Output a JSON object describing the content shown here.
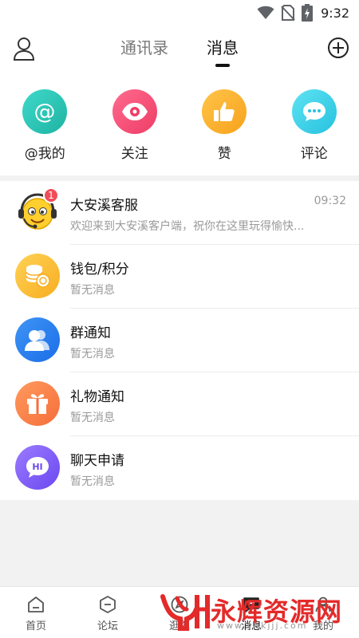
{
  "status_bar": {
    "time": "9:32"
  },
  "header": {
    "tabs": [
      {
        "label": "通讯录",
        "active": false
      },
      {
        "label": "消息",
        "active": true
      }
    ]
  },
  "quick_actions": [
    {
      "label": "@我的",
      "icon": "at-icon",
      "color": "#2ec4b6"
    },
    {
      "label": "关注",
      "icon": "eye-icon",
      "color": "#f2506f"
    },
    {
      "label": "赞",
      "icon": "thumbs-up-icon",
      "color": "#f9b02d"
    },
    {
      "label": "评论",
      "icon": "comment-icon",
      "color": "#3dcfe7"
    }
  ],
  "messages": [
    {
      "title": "大安溪客服",
      "subtitle": "欢迎来到大安溪客户端，祝你在这里玩得愉快...",
      "time": "09:32",
      "badge": "1",
      "icon": "customer-service-avatar-icon"
    },
    {
      "title": "钱包/积分",
      "subtitle": "暂无消息",
      "icon": "coins-icon"
    },
    {
      "title": "群通知",
      "subtitle": "暂无消息",
      "icon": "group-icon"
    },
    {
      "title": "礼物通知",
      "subtitle": "暂无消息",
      "icon": "gift-icon"
    },
    {
      "title": "聊天申请",
      "subtitle": "暂无消息",
      "icon": "chat-hi-icon"
    }
  ],
  "bottom_nav": [
    {
      "label": "首页",
      "icon": "home-icon"
    },
    {
      "label": "论坛",
      "icon": "forum-icon"
    },
    {
      "label": "逛逛",
      "icon": "explore-icon"
    },
    {
      "label": "消息",
      "icon": "message-icon",
      "active": true
    },
    {
      "label": "我的",
      "icon": "profile-icon"
    }
  ],
  "watermark": {
    "text": "永辉资源网",
    "url": "www.yhkjjj.com"
  }
}
